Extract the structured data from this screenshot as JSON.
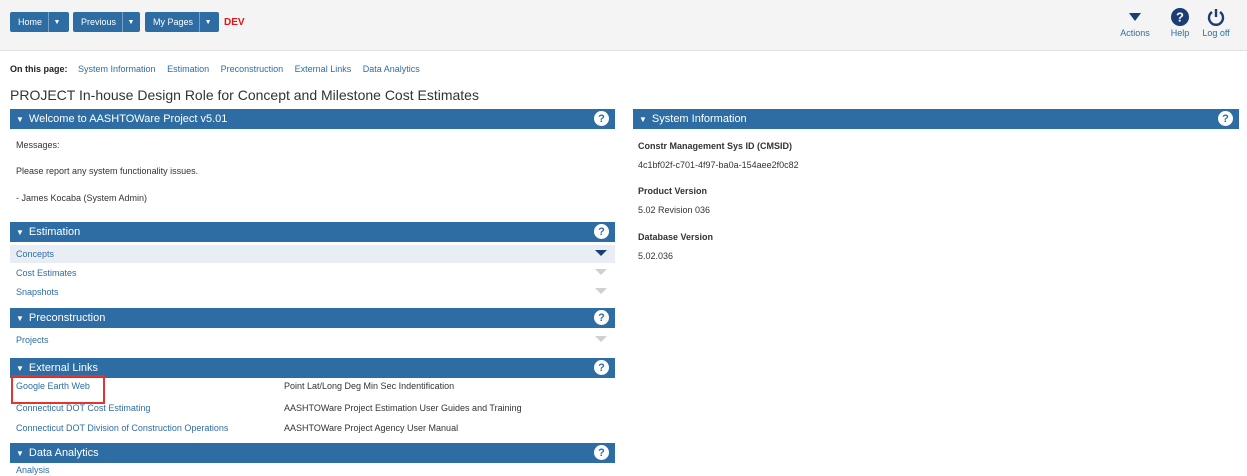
{
  "nav": {
    "home": "Home",
    "previous": "Previous",
    "my_pages": "My Pages",
    "env": "DEV",
    "actions": "Actions",
    "help": "Help",
    "logoff": "Log off"
  },
  "on_this_page": {
    "label": "On this page:",
    "links": [
      "System Information",
      "Estimation",
      "Preconstruction",
      "External Links",
      "Data Analytics"
    ]
  },
  "page_title": "PROJECT In-house Design Role for Concept and Milestone Cost Estimates",
  "welcome": {
    "header": "Welcome to AASHTOWare Project v5.01",
    "messages_label": "Messages:",
    "message": "Please report any system functionality issues.",
    "signature": "- James Kocaba (System Admin)"
  },
  "estimation": {
    "header": "Estimation",
    "items": [
      "Concepts",
      "Cost Estimates",
      "Snapshots"
    ]
  },
  "preconstruction": {
    "header": "Preconstruction",
    "items": [
      "Projects"
    ]
  },
  "external_links": {
    "header": "External Links",
    "col1": [
      "Google Earth Web",
      "Connecticut DOT Cost Estimating",
      "Connecticut DOT Division of Construction Operations"
    ],
    "col2": [
      "Point Lat/Long Deg Min Sec Indentification",
      "AASHTOWare Project Estimation User Guides and Training",
      "AASHTOWare Project Agency User Manual"
    ]
  },
  "data_analytics": {
    "header": "Data Analytics",
    "items": [
      "Analysis"
    ]
  },
  "system_info": {
    "header": "System Information",
    "cmsid_label": "Constr Management Sys ID (CMSID)",
    "cmsid_value": "4c1bf02f-c701-4f97-ba0a-154aee2f0c82",
    "product_label": "Product Version",
    "product_value": "5.02 Revision 036",
    "db_label": "Database Version",
    "db_value": "5.02.036"
  },
  "help_glyph": "?",
  "colors": {
    "header_blue": "#2e6da4",
    "env_red": "#e0161a",
    "highlight_box": "#e3342f"
  }
}
